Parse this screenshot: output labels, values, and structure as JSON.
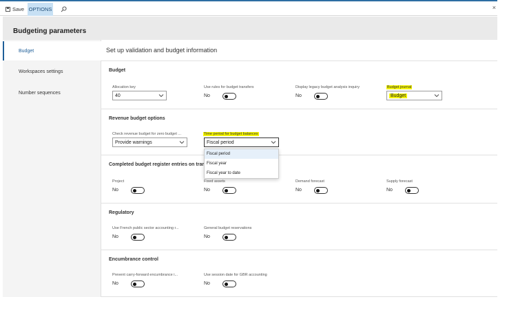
{
  "toolbar": {
    "save_label": "Save",
    "options_label": "OPTIONS",
    "search_icon": "search-icon",
    "close_label": "×"
  },
  "page": {
    "title": "Budgeting parameters"
  },
  "nav": {
    "items": [
      {
        "label": "Budget",
        "active": true
      },
      {
        "label": "Workspaces settings",
        "active": false
      },
      {
        "label": "Number sequences",
        "active": false
      }
    ]
  },
  "content": {
    "title": "Set up validation and budget information"
  },
  "budget": {
    "title": "Budget",
    "allocation_key": {
      "label": "Allocation key",
      "value": "40"
    },
    "use_rules": {
      "label": "Use rules for budget transfers",
      "value": "No"
    },
    "display_legacy": {
      "label": "Display legacy budget analysis inquiry",
      "value": "No"
    },
    "budget_journal": {
      "label": "Budget journal",
      "value": "Budget"
    }
  },
  "revenue": {
    "title": "Revenue budget options",
    "check_revenue": {
      "label": "Check revenue budget for zero budget ...",
      "value": "Provide warnings"
    },
    "time_period": {
      "label": "Time period for budget balances",
      "value": "Fiscal period"
    }
  },
  "dropdown": {
    "options": [
      "Fiscal period",
      "Fiscal year",
      "Fiscal year to date"
    ],
    "selected_index": 0
  },
  "completed": {
    "title": "Completed budget register entries on transf",
    "project": {
      "label": "Project",
      "value": "No"
    },
    "fixed_assets": {
      "label": "Fixed assets",
      "value": "No"
    },
    "demand_forecast": {
      "label": "Demand forecast",
      "value": "No"
    },
    "supply_forecast": {
      "label": "Supply forecast",
      "value": "No"
    }
  },
  "regulatory": {
    "title": "Regulatory",
    "french": {
      "label": "Use French public sector accounting r...",
      "value": "No"
    },
    "general_reservations": {
      "label": "General budget reservations",
      "value": "No"
    }
  },
  "encumbrance": {
    "title": "Encumbrance control",
    "prevent": {
      "label": "Prevent carry-forward encumbrance i...",
      "value": "No"
    },
    "session_date": {
      "label": "Use session date for GBR accounting",
      "value": "No"
    }
  },
  "colors": {
    "accent": "#2d6da3",
    "highlight": "#f4f400",
    "options_bg": "#c7e0f4"
  }
}
